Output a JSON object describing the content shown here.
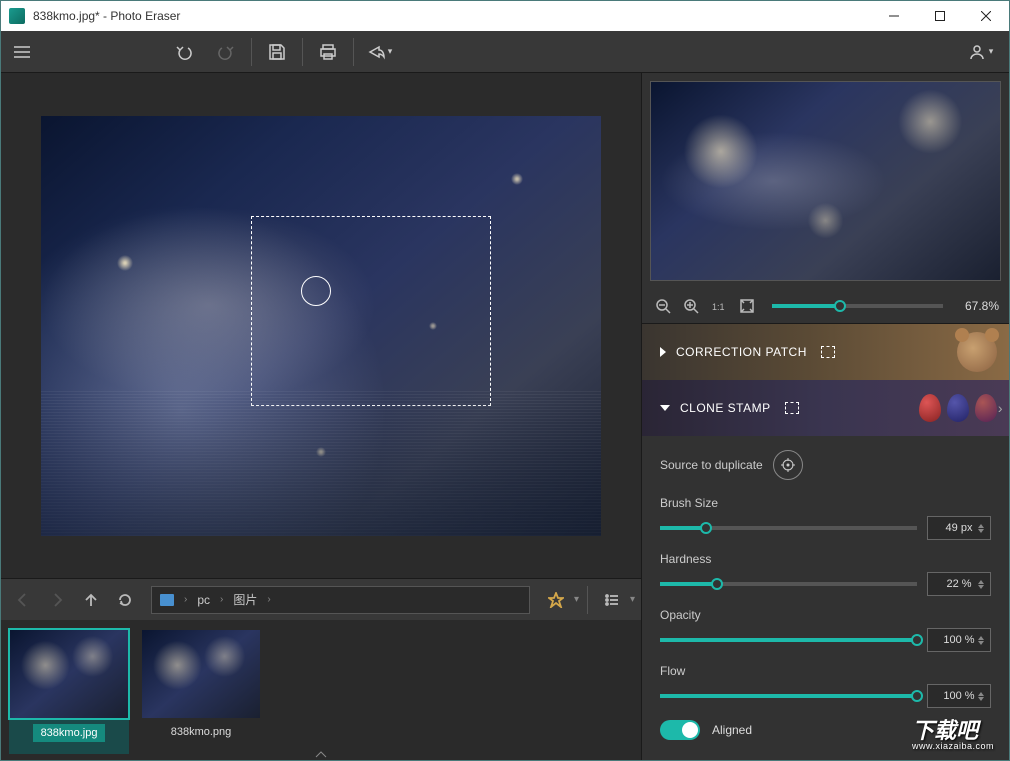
{
  "title": "838kmo.jpg* - Photo Eraser",
  "breadcrumb": {
    "root": "pc",
    "folder": "图片"
  },
  "thumbnails": [
    {
      "name": "838kmo.jpg",
      "active": true
    },
    {
      "name": "838kmo.png",
      "active": false
    }
  ],
  "zoom": {
    "value": "67.8%"
  },
  "panels": {
    "correction_patch": "CORRECTION PATCH",
    "clone_stamp": "CLONE STAMP"
  },
  "clone": {
    "source_label": "Source to duplicate",
    "brush_size": {
      "label": "Brush Size",
      "value": "49 px",
      "pct": 18
    },
    "hardness": {
      "label": "Hardness",
      "value": "22 %",
      "pct": 22
    },
    "opacity": {
      "label": "Opacity",
      "value": "100 %",
      "pct": 100
    },
    "flow": {
      "label": "Flow",
      "value": "100 %",
      "pct": 100
    },
    "aligned": {
      "label": "Aligned",
      "on": true
    }
  },
  "watermark": {
    "text": "下载吧",
    "url": "www.xiazaiba.com"
  }
}
